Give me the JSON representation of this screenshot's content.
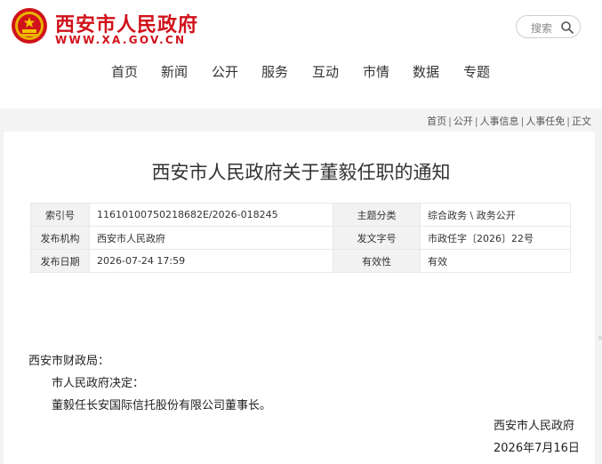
{
  "header": {
    "site_name": "西安市人民政府",
    "site_url": "WWW.XA.GOV.CN",
    "emblem_icon": "national-emblem-icon",
    "brand_color": "#d0121b"
  },
  "search": {
    "placeholder": "搜索",
    "icon": "search-icon"
  },
  "nav": {
    "items": [
      {
        "label": "首页"
      },
      {
        "label": "新闻"
      },
      {
        "label": "公开"
      },
      {
        "label": "服务"
      },
      {
        "label": "互动"
      },
      {
        "label": "市情"
      },
      {
        "label": "数据"
      },
      {
        "label": "专题"
      }
    ]
  },
  "breadcrumb": {
    "items": [
      "首页",
      "公开",
      "人事信息",
      "人事任免",
      "正文"
    ],
    "separator": "|"
  },
  "article": {
    "title": "西安市人民政府关于董毅任职的通知",
    "meta": {
      "index_label": "索引号",
      "index_value": "11610100750218682E/2026-018245",
      "category_label": "主题分类",
      "category_value": "综合政务 \\ 政务公开",
      "issuer_label": "发布机构",
      "issuer_value": "西安市人民政府",
      "doc_no_label": "发文字号",
      "doc_no_value": "市政任字〔2026〕22号",
      "date_label": "发布日期",
      "date_value": "2026-07-24 17:59",
      "validity_label": "有效性",
      "validity_value": "有效"
    },
    "recipient": "西安市财政局：",
    "paragraphs": [
      "市人民政府决定：",
      "董毅任长安国际信托股份有限公司董事长。"
    ],
    "signature": "西安市人民政府",
    "signed_date": "2026年7月16日"
  }
}
